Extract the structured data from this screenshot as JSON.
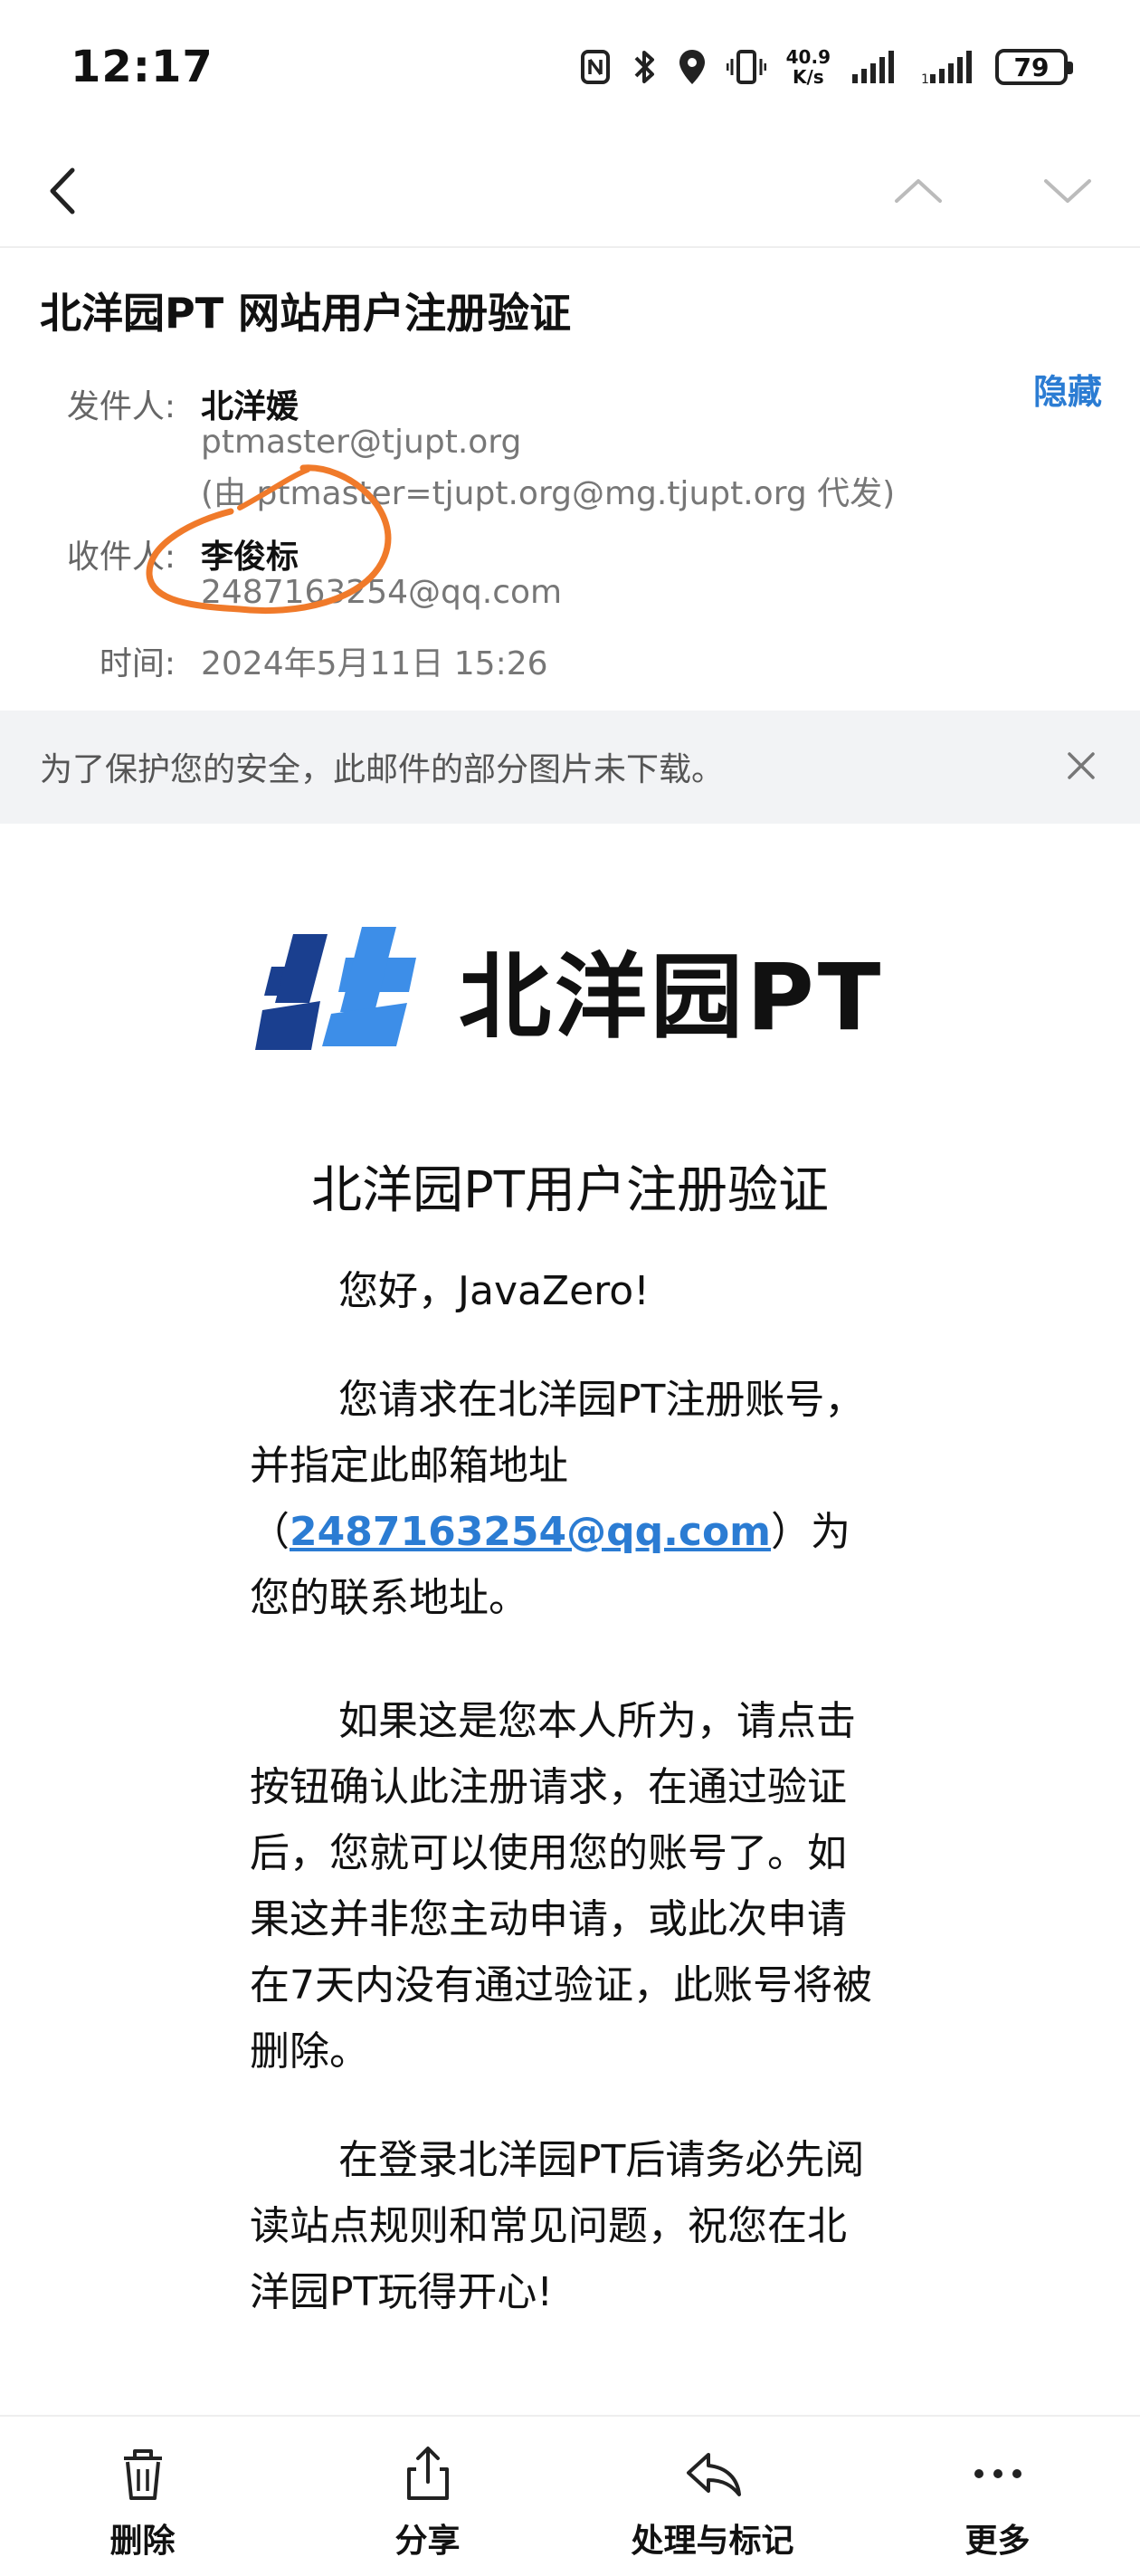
{
  "status": {
    "time": "12:17",
    "speed_value": "40.9",
    "speed_unit": "K/s",
    "battery": "79"
  },
  "email": {
    "subject": "北洋园PT 网站用户注册验证",
    "hide_label": "隐藏",
    "from_label": "发件人:",
    "from_name": "北洋媛",
    "from_email": "ptmaster@tjupt.org",
    "from_via": "(由 ptmaster=tjupt.org@mg.tjupt.org 代发)",
    "to_label": "收件人:",
    "to_name": "李俊标",
    "to_email": "2487163254@qq.com",
    "time_label": "时间:",
    "time_value": "2024年5月11日 15:26"
  },
  "notice": {
    "text": "为了保护您的安全，此邮件的部分图片未下载。"
  },
  "body": {
    "logo_text": "北洋园PT",
    "title": "北洋园PT用户注册验证",
    "greeting": "您好，JavaZero!",
    "p1_before": "您请求在北洋园PT注册账号，并指定此邮箱地址（",
    "p1_link": "2487163254@qq.com",
    "p1_after": "）为您的联系地址。",
    "p2": "如果这是您本人所为，请点击按钮确认此注册请求，在通过验证后，您就可以使用您的账号了。如果这并非您主动申请，或此次申请在7天内没有通过验证，此账号将被删除。",
    "p3": "在登录北洋园PT后请务必先阅读站点规则和常见问题，祝您在北洋园PT玩得开心!"
  },
  "toolbar": {
    "delete": "删除",
    "share": "分享",
    "process": "处理与标记",
    "more": "更多"
  },
  "colors": {
    "link": "#2b7cd3",
    "annotation": "#f07a2a",
    "logo_dark": "#1a3f8f",
    "logo_light": "#3d8ee8"
  }
}
